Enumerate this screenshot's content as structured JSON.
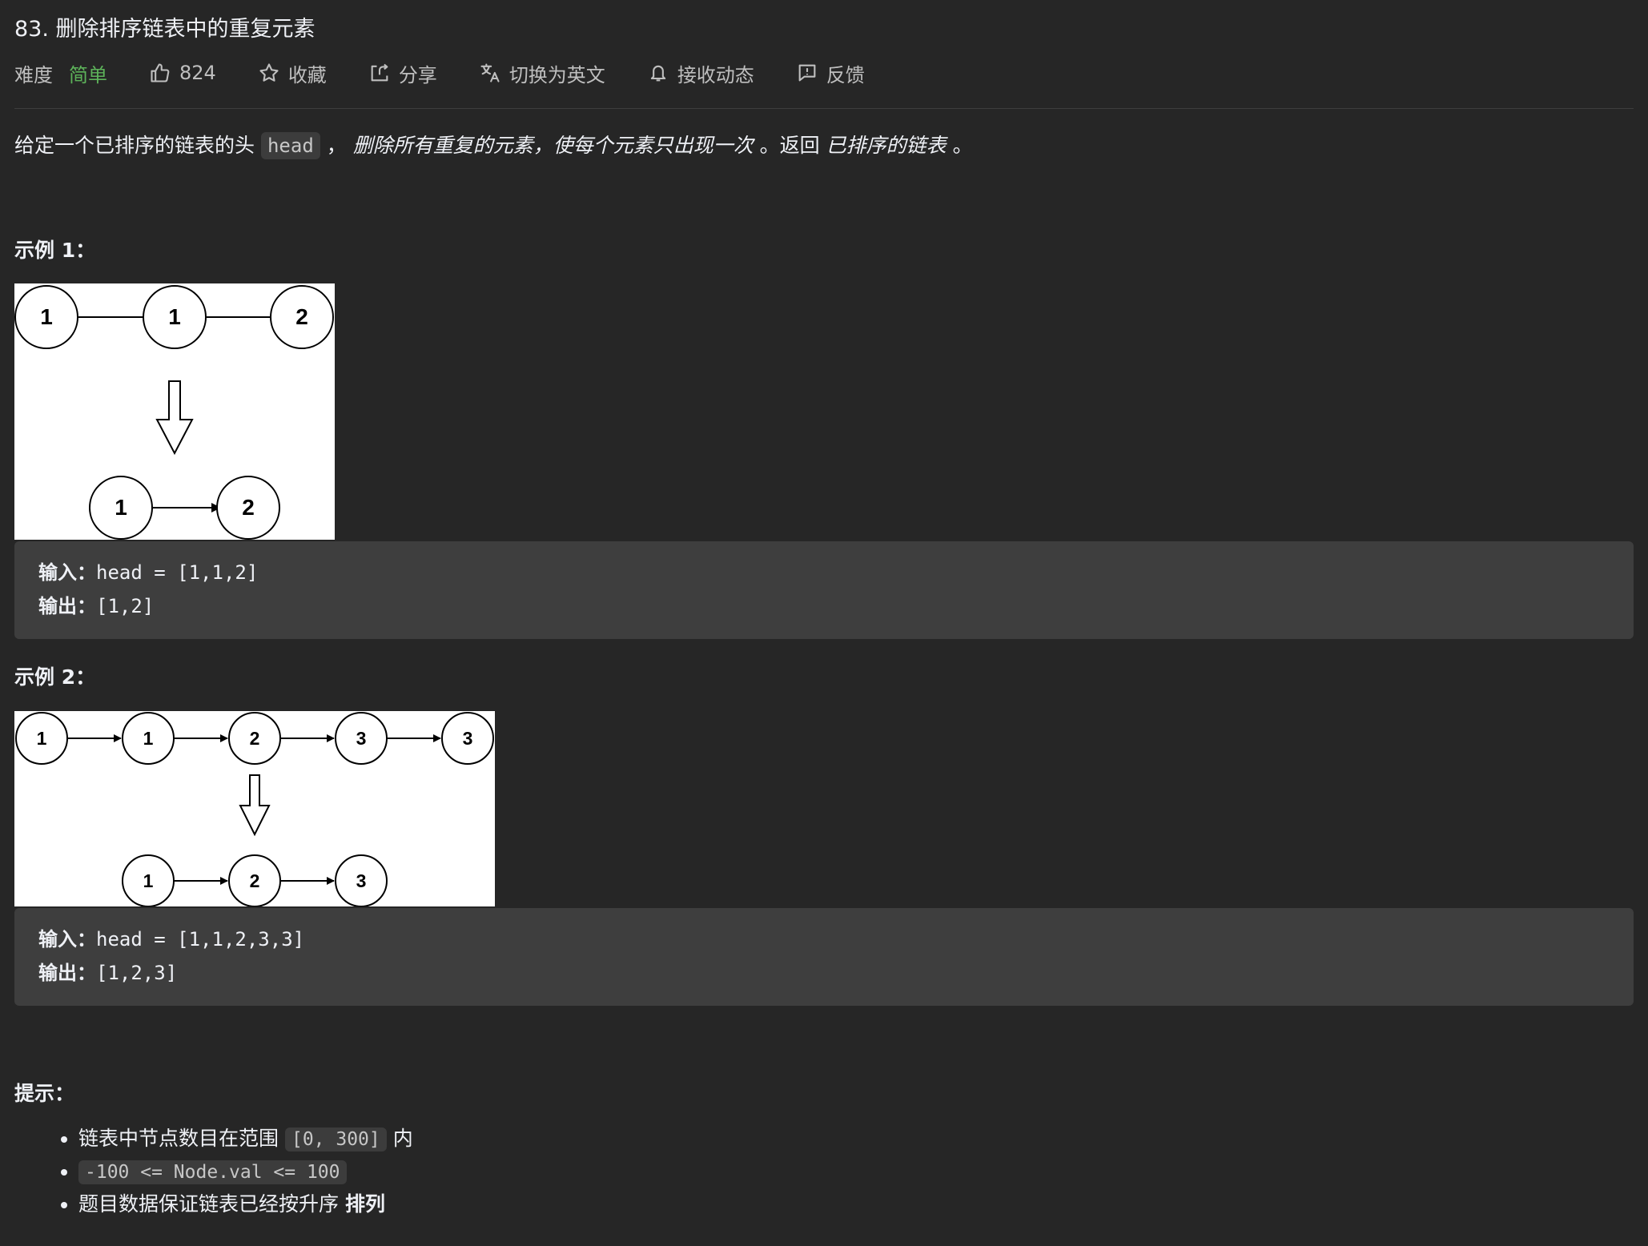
{
  "header": {
    "title": "83. 删除排序链表中的重复元素",
    "difficulty_label": "难度",
    "difficulty_value": "简单",
    "likes": "824",
    "favorite": "收藏",
    "share": "分享",
    "translate": "切换为英文",
    "subscribe": "接收动态",
    "feedback": "反馈"
  },
  "description": {
    "prefix": "给定一个已排序的链表的头",
    "code": "head",
    "comma": "，",
    "italic1": "删除所有重复的元素，使每个元素只出现一次",
    "mid": "。返回",
    "italic2": "已排序的链表",
    "end": "。"
  },
  "examples": [
    {
      "title": "示例 1：",
      "top_nodes": [
        "1",
        "1",
        "2"
      ],
      "bottom_nodes": [
        "1",
        "2"
      ],
      "input_label": "输入：",
      "input_value": "head = [1,1,2]",
      "output_label": "输出：",
      "output_value": "[1,2]"
    },
    {
      "title": "示例 2：",
      "top_nodes": [
        "1",
        "1",
        "2",
        "3",
        "3"
      ],
      "bottom_nodes": [
        "1",
        "2",
        "3"
      ],
      "input_label": "输入：",
      "input_value": "head = [1,1,2,3,3]",
      "output_label": "输出：",
      "output_value": "[1,2,3]"
    }
  ],
  "tips": {
    "title": "提示：",
    "item1_prefix": "链表中节点数目在范围",
    "item1_code": "[0, 300]",
    "item1_suffix": "内",
    "item2_code": "-100 <= Node.val <= 100",
    "item3_prefix": "题目数据保证链表已经按升序",
    "item3_bold": "排列"
  },
  "colors": {
    "background": "#262626",
    "text": "#eff1f6",
    "easy": "#5db35a",
    "code_bg": "#3e3e3e"
  }
}
